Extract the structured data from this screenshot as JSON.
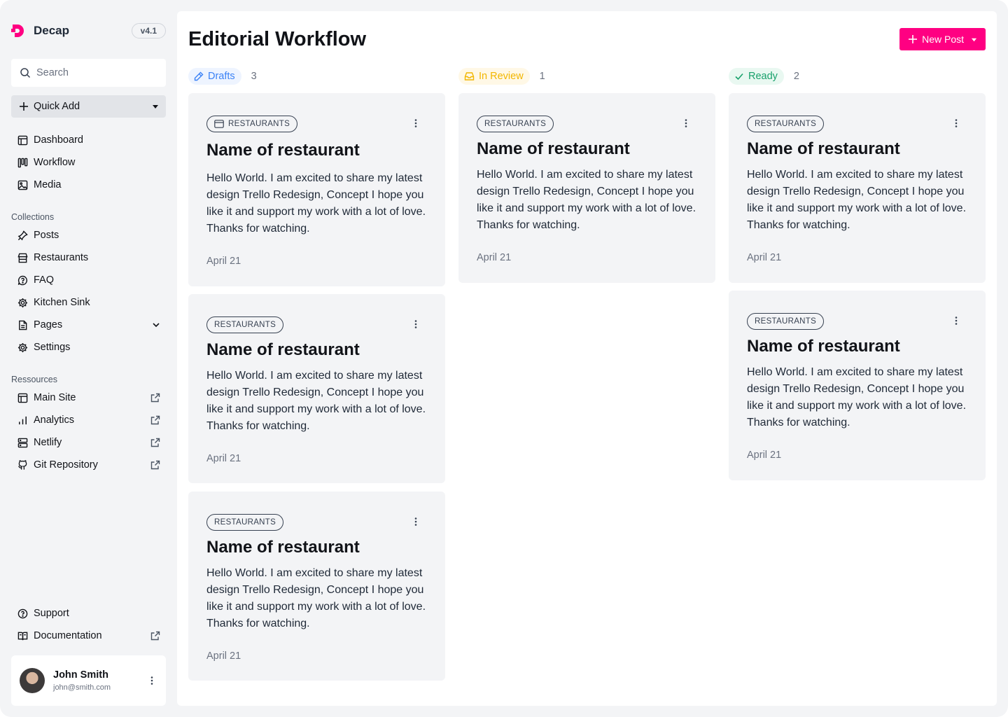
{
  "app": {
    "name": "Decap",
    "version": "v4.1"
  },
  "colors": {
    "brand": "#ff0082",
    "drafts": "#3b82f6",
    "in_review": "#f2b600",
    "ready": "#18a16b"
  },
  "sidebar": {
    "search_placeholder": "Search",
    "quick_add": "Quick Add",
    "main_items": [
      {
        "label": "Dashboard",
        "icon": "layout-icon"
      },
      {
        "label": "Workflow",
        "icon": "kanban-icon"
      },
      {
        "label": "Media",
        "icon": "image-icon"
      }
    ],
    "collections_label": "Collections",
    "collections": [
      {
        "label": "Posts",
        "icon": "pin-icon"
      },
      {
        "label": "Restaurants",
        "icon": "store-icon"
      },
      {
        "label": "FAQ",
        "icon": "help-bubble-icon"
      },
      {
        "label": "Kitchen Sink",
        "icon": "cog-icon"
      },
      {
        "label": "Pages",
        "icon": "file-icon"
      },
      {
        "label": "Settings",
        "icon": "settings-icon"
      }
    ],
    "resources_label": "Ressources",
    "resources": [
      {
        "label": "Main Site",
        "icon": "layout-icon"
      },
      {
        "label": "Analytics",
        "icon": "bar-chart-icon"
      },
      {
        "label": "Netlify",
        "icon": "server-icon"
      },
      {
        "label": "Git Repository",
        "icon": "github-icon"
      }
    ],
    "footer_items": [
      {
        "label": "Support",
        "icon": "help-circle-icon"
      },
      {
        "label": "Documentation",
        "icon": "book-icon"
      }
    ],
    "user": {
      "name": "John Smith",
      "email": "john@smith.com"
    }
  },
  "main": {
    "title": "Editorial Workflow",
    "new_post": "New Post",
    "columns": [
      {
        "label": "Drafts",
        "count": "3",
        "cards": [
          {
            "tag": "RESTAURANTS",
            "title": "Name of restaurant",
            "body": "Hello World. I am excited to share my latest design Trello Redesign, Concept I hope you like it and support my work with a lot of love. Thanks for watching.",
            "date": "April 21"
          },
          {
            "tag": "RESTAURANTS",
            "title": "Name of restaurant",
            "body": "Hello World. I am excited to share my latest design Trello Redesign, Concept I hope you like it and support my work with a lot of love. Thanks for watching.",
            "date": "April 21"
          },
          {
            "tag": "RESTAURANTS",
            "title": "Name of restaurant",
            "body": "Hello World. I am excited to share my latest design Trello Redesign, Concept I hope you like it and support my work with a lot of love. Thanks for watching.",
            "date": "April 21"
          }
        ]
      },
      {
        "label": "In Review",
        "count": "1",
        "cards": [
          {
            "tag": "RESTAURANTS",
            "title": "Name of restaurant",
            "body": "Hello World. I am excited to share my latest design Trello Redesign, Concept I hope you like it and support my work with a lot of love. Thanks for watching.",
            "date": "April 21"
          }
        ]
      },
      {
        "label": "Ready",
        "count": "2",
        "cards": [
          {
            "tag": "RESTAURANTS",
            "title": "Name of restaurant",
            "body": "Hello World. I am excited to share my latest design Trello Redesign, Concept I hope you like it and support my work with a lot of love. Thanks for watching.",
            "date": "April 21"
          },
          {
            "tag": "RESTAURANTS",
            "title": "Name of restaurant",
            "body": "Hello World. I am excited to share my latest design Trello Redesign, Concept I hope you like it and support my work with a lot of love. Thanks for watching.",
            "date": "April 21"
          }
        ]
      }
    ]
  }
}
